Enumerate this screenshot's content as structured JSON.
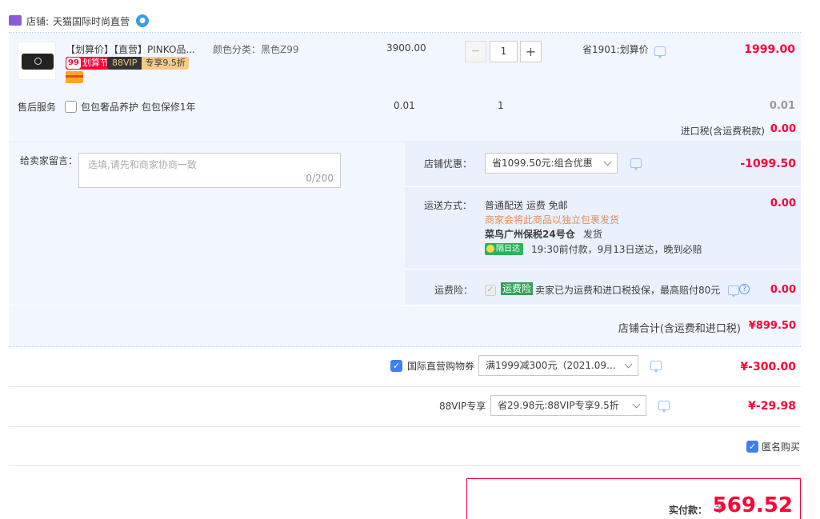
{
  "shop": {
    "label": "店铺:",
    "name": "天猫国际时尚直营"
  },
  "item": {
    "title": "【划算价】【直营】PINKO品...",
    "sku": "颜色分类：黑色Z99",
    "orig_price": "3900.00",
    "qty": "1",
    "minus": "−",
    "plus": "+",
    "discount_text": "省1901:划算价",
    "subtotal": "1999.00",
    "badge_99": "划算节",
    "badge_99_num": "99",
    "badge_vip": "88VIP",
    "badge_vip_text": "专享9.5折"
  },
  "after_sale": {
    "label": "售后服务",
    "option": "包包奢品养护 包包保修1年",
    "price": "0.01",
    "qty": "1",
    "subtotal": "0.01"
  },
  "import_tax": {
    "label": "进口税(含运费税款)",
    "value": "0.00"
  },
  "message": {
    "label": "给卖家留言：",
    "placeholder": "选填,请先和商家协商一致",
    "counter": "0/200"
  },
  "shop_discount": {
    "label": "店铺优惠：",
    "selected": "省1099.50元:组合优惠",
    "value": "-1099.50"
  },
  "shipping": {
    "label": "运送方式：",
    "method": "普通配送 运费 免邮",
    "note": "商家会将此商品以独立包裹发货",
    "warehouse": "菜鸟广州保税24号仓",
    "warehouse_action": "发货",
    "tag": "隔日达",
    "eta": "19:30前付款，9月13日送达，晚到必赔",
    "value": "0.00"
  },
  "insurance": {
    "label": "运费险：",
    "tag": "运费险",
    "text": "卖家已为运费和进口税投保，最高赔付80元",
    "help": "?",
    "value": "0.00"
  },
  "shop_total": {
    "label": "店铺合计(含运费和进口税)",
    "value": "¥899.50"
  },
  "coupon": {
    "label": "国际直营购物券",
    "selected": "满1999减300元（2021.09...",
    "value": "¥-300.00"
  },
  "vip": {
    "label": "88VIP专享",
    "selected": "省29.98元:88VIP专享9.5折",
    "value": "¥-29.98"
  },
  "anonymous": {
    "label": "匿名购买"
  },
  "pay": {
    "label": "实付款：",
    "currency": "¥",
    "amount": "569.52"
  },
  "colors": {
    "accent_red": "#ff0036",
    "light_blue_bg": "#f2f7ff",
    "blue_check": "#3e7ff1"
  }
}
